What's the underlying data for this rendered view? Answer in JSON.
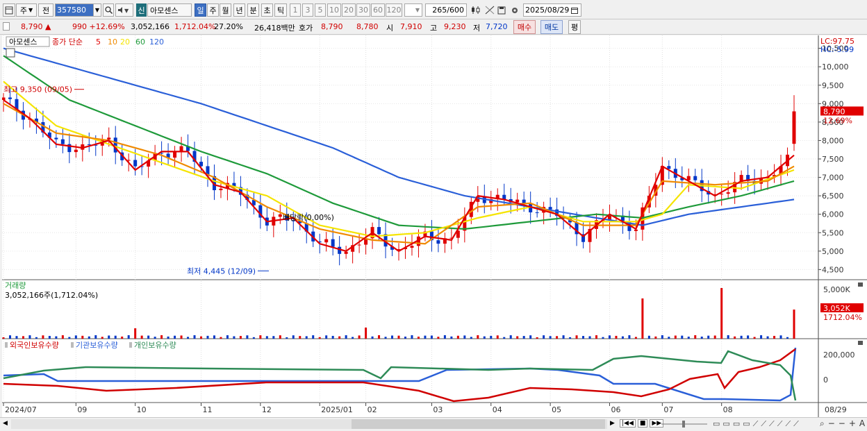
{
  "toolbar": {
    "period_unit": "주",
    "prev_label": "전",
    "code": "357580",
    "new_label": "신",
    "stock_name": "아모센스",
    "periods": [
      "일",
      "주",
      "월",
      "년",
      "분",
      "초",
      "틱"
    ],
    "active_period": "일",
    "intervals": [
      "1",
      "3",
      "5",
      "10",
      "20",
      "30",
      "60",
      "120"
    ],
    "count_label": "265/600",
    "date": "2025/08/29"
  },
  "quote": {
    "price": "8,790 ▲",
    "change": "990 +12.69%",
    "volume": "3,052,166",
    "volume_ratio": "1,712.04%",
    "turnover": "27.20%",
    "amount": "26,418백만",
    "hoga_label": "호가",
    "hoga_sell": "8,790",
    "hoga_buy": "8,780",
    "open_label": "시",
    "open": "7,910",
    "high_label": "고",
    "high": "9,230",
    "low_label": "저",
    "low": "7,720",
    "buy_btn": "매수",
    "sell_btn": "매도",
    "eval_btn": "평"
  },
  "price_panel": {
    "legend_name": "아모센스",
    "legend_ma_label": "종가 단순",
    "ma_periods": [
      "5",
      "10",
      "20",
      "60",
      "120"
    ],
    "lc": "LC:97.75",
    "hc": "HC:-5.99",
    "yticks": [
      "10,500",
      "10,000",
      "9,500",
      "9,000",
      "8,500",
      "8,000",
      "7,500",
      "7,000",
      "6,500",
      "6,000",
      "5,500",
      "5,000",
      "4,500"
    ],
    "current_price": "8,790",
    "current_change": "12.69%",
    "high_annot": "최고 9,350 (09/05)",
    "low_annot": "최저 4,445 (12/09)",
    "div_annot": "배당락(0.00%)",
    "colors": {
      "ma5": "#e00000",
      "ma10": "#f08a00",
      "ma20": "#f5e400",
      "ma60": "#1e9a3a",
      "ma120": "#2a5fd8"
    }
  },
  "volume_panel": {
    "title": "거래량",
    "value": "3,052,166주(1,712.04%)",
    "ytick": "5,000K",
    "current": "3,052K",
    "current_pct": "1712.04%"
  },
  "holder_panel": {
    "legends": [
      "외국인보유수량",
      "기관보유수량",
      "개인보유수량"
    ],
    "yticks": [
      "200,000",
      "0"
    ]
  },
  "xaxis": {
    "labels": [
      "2024/07",
      "09",
      "10",
      "11",
      "12",
      "2025/01",
      "02",
      "03",
      "04",
      "05",
      "06",
      "07",
      "08"
    ],
    "end_label": "08/29"
  },
  "chart_data": {
    "type": "candlestick",
    "title": "아모센스",
    "x_range": [
      "2024/07",
      "2025/08/29"
    ],
    "ylim": [
      4300,
      10700
    ],
    "series": [
      {
        "name": "5",
        "approx_points": [
          [
            0,
            9100
          ],
          [
            4,
            8600
          ],
          [
            8,
            7900
          ],
          [
            12,
            7800
          ],
          [
            16,
            8000
          ],
          [
            20,
            7200
          ],
          [
            24,
            7700
          ],
          [
            28,
            7700
          ],
          [
            32,
            6800
          ],
          [
            36,
            6600
          ],
          [
            40,
            5800
          ],
          [
            44,
            5900
          ],
          [
            48,
            5200
          ],
          [
            52,
            5000
          ],
          [
            56,
            5500
          ],
          [
            60,
            5000
          ],
          [
            64,
            5400
          ],
          [
            68,
            5300
          ],
          [
            72,
            6500
          ],
          [
            76,
            6400
          ],
          [
            80,
            6200
          ],
          [
            84,
            6000
          ],
          [
            88,
            5400
          ],
          [
            92,
            6000
          ],
          [
            96,
            5600
          ],
          [
            100,
            7300
          ],
          [
            104,
            6900
          ],
          [
            108,
            6500
          ],
          [
            112,
            6900
          ],
          [
            116,
            7000
          ],
          [
            120,
            7600
          ]
        ]
      },
      {
        "name": "10",
        "approx_points": [
          [
            0,
            9000
          ],
          [
            8,
            8200
          ],
          [
            16,
            8000
          ],
          [
            24,
            7600
          ],
          [
            32,
            7000
          ],
          [
            40,
            6200
          ],
          [
            48,
            5600
          ],
          [
            56,
            5300
          ],
          [
            64,
            5200
          ],
          [
            72,
            6200
          ],
          [
            80,
            6300
          ],
          [
            88,
            5700
          ],
          [
            96,
            5700
          ],
          [
            100,
            6900
          ],
          [
            108,
            6800
          ],
          [
            116,
            6900
          ],
          [
            120,
            7300
          ]
        ]
      },
      {
        "name": "20",
        "approx_points": [
          [
            0,
            9600
          ],
          [
            8,
            8400
          ],
          [
            16,
            7900
          ],
          [
            24,
            7400
          ],
          [
            32,
            6900
          ],
          [
            40,
            6500
          ],
          [
            48,
            5700
          ],
          [
            56,
            5400
          ],
          [
            64,
            5500
          ],
          [
            72,
            5900
          ],
          [
            80,
            6200
          ],
          [
            88,
            5800
          ],
          [
            96,
            5800
          ],
          [
            100,
            6000
          ],
          [
            104,
            6800
          ],
          [
            112,
            6700
          ],
          [
            120,
            7200
          ]
        ]
      },
      {
        "name": "60",
        "approx_points": [
          [
            0,
            10300
          ],
          [
            10,
            9100
          ],
          [
            20,
            8400
          ],
          [
            30,
            7700
          ],
          [
            40,
            7100
          ],
          [
            50,
            6300
          ],
          [
            60,
            5700
          ],
          [
            70,
            5600
          ],
          [
            80,
            5800
          ],
          [
            90,
            6000
          ],
          [
            97,
            5900
          ],
          [
            104,
            6200
          ],
          [
            112,
            6500
          ],
          [
            120,
            6900
          ]
        ]
      },
      {
        "name": "120",
        "approx_points": [
          [
            0,
            10500
          ],
          [
            10,
            10000
          ],
          [
            20,
            9500
          ],
          [
            30,
            9000
          ],
          [
            40,
            8400
          ],
          [
            50,
            7800
          ],
          [
            60,
            7000
          ],
          [
            70,
            6500
          ],
          [
            80,
            6200
          ],
          [
            90,
            5900
          ],
          [
            97,
            5700
          ],
          [
            104,
            6000
          ],
          [
            112,
            6200
          ],
          [
            120,
            6400
          ]
        ]
      }
    ],
    "annotations": [
      {
        "text": "최고 9,350 (09/05)",
        "value": 9350
      },
      {
        "text": "최저 4,445 (12/09)",
        "value": 4445
      }
    ],
    "last": {
      "close": 8790,
      "open": 7910,
      "high": 9230,
      "low": 7720
    }
  }
}
